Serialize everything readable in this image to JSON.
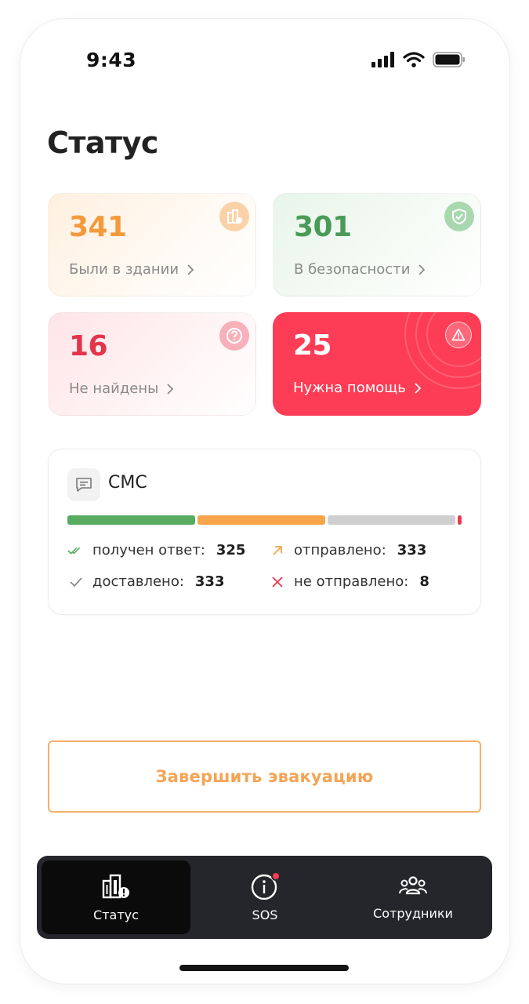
{
  "status_bar": {
    "time": "9:43"
  },
  "page": {
    "title": "Статус"
  },
  "cards": [
    {
      "value": "341",
      "label": "Были в здании",
      "icon": "building-alert-icon"
    },
    {
      "value": "301",
      "label": "В безопасности",
      "icon": "shield-check-icon"
    },
    {
      "value": "16",
      "label": "Не найдены",
      "icon": "question-icon"
    },
    {
      "value": "25",
      "label": "Нужна помощь",
      "icon": "warning-icon"
    }
  ],
  "sms": {
    "title": "СМС",
    "stats": {
      "answered_label": "получен ответ:",
      "answered": "325",
      "sent_label": "отправлено:",
      "sent": "333",
      "delivered_label": "доставлено:",
      "delivered": "333",
      "not_sent_label": "не отправлено:",
      "not_sent": "8"
    },
    "colors": {
      "answered": "#58ac62",
      "sent": "#f7a44b",
      "delivered": "#cfcfcf",
      "not_sent": "#e8394f"
    }
  },
  "actions": {
    "finish_label": "Завершить эвакуацию"
  },
  "tabbar": {
    "items": [
      {
        "label": "Статус",
        "icon": "building-alert-icon",
        "active": true
      },
      {
        "label": "SOS",
        "icon": "info-icon",
        "badge": true
      },
      {
        "label": "Сотрудники",
        "icon": "people-icon"
      }
    ]
  }
}
